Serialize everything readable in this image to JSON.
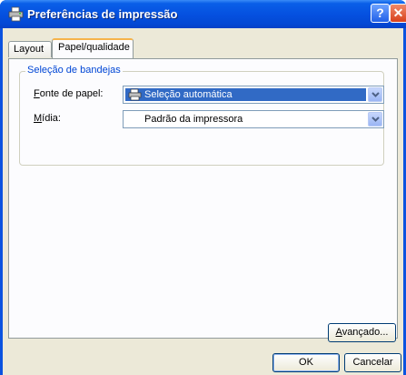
{
  "window": {
    "title": "Preferências de impressão",
    "help_label": "?",
    "close_label": "✕"
  },
  "tabs": [
    {
      "label": "Layout",
      "active": false
    },
    {
      "label": "Papel/qualidade",
      "active": true
    }
  ],
  "tray_group": {
    "legend": "Seleção de bandejas",
    "paper_source": {
      "label_accel": "F",
      "label_rest": "onte de papel:",
      "value": "Seleção automática",
      "icon": "printer-icon"
    },
    "media": {
      "label_accel": "M",
      "label_rest": "ídia:",
      "value": "Padrão da impressora"
    }
  },
  "buttons": {
    "advanced_accel": "A",
    "advanced_rest": "vançado...",
    "ok": "OK",
    "cancel": "Cancelar"
  },
  "colors": {
    "titlebar": "#0551e0",
    "selection": "#316ac5",
    "legend_text": "#0046d5",
    "dialog_bg": "#ece9d8"
  }
}
